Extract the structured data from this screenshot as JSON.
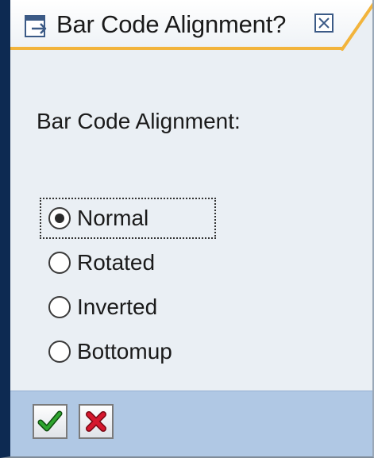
{
  "dialog": {
    "title": "Bar Code Alignment?",
    "title_icon": "dialog-window-icon",
    "close_icon": "close-icon"
  },
  "content": {
    "label": "Bar Code Alignment:",
    "selected": "Normal",
    "options": [
      {
        "label": "Normal",
        "checked": true
      },
      {
        "label": "Rotated",
        "checked": false
      },
      {
        "label": "Inverted",
        "checked": false
      },
      {
        "label": "Bottomup",
        "checked": false
      }
    ]
  },
  "footer": {
    "confirm_icon": "checkmark-icon",
    "cancel_icon": "cancel-x-icon"
  },
  "colors": {
    "window_frame": "#0d2a52",
    "dialog_bg": "#eaeff4",
    "title_accent": "#f2b43c",
    "footer_bg": "#b0c8e4",
    "confirm_green": "#1f8a1f",
    "cancel_red": "#c8102e"
  }
}
